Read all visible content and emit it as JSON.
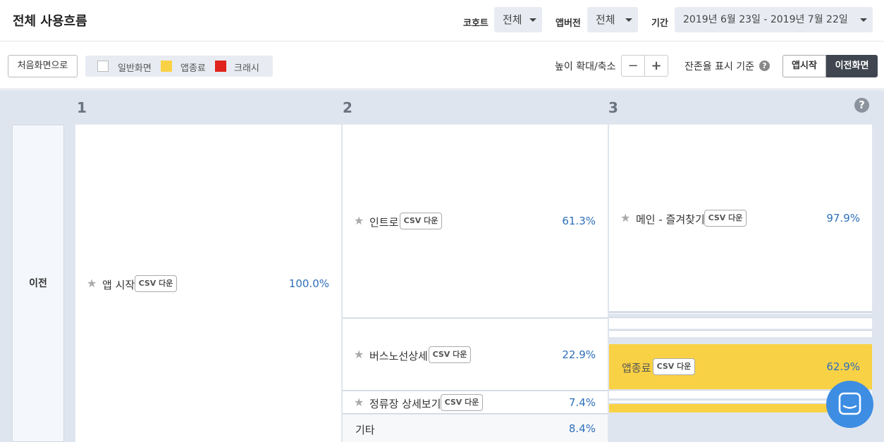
{
  "header": {
    "title": "전체 사용흐름",
    "cohort_label": "코호트",
    "cohort_value": "전체",
    "app_version_label": "앱버전",
    "app_version_value": "전체",
    "period_label": "기간",
    "period_value": "2019년 6월 23일 - 2019년 7월 22일"
  },
  "toolbar": {
    "home_button": "처음화면으로",
    "legend": [
      {
        "label": "일반화면",
        "color": "#ffffff"
      },
      {
        "label": "앱종료",
        "color": "#f9d144"
      },
      {
        "label": "크래시",
        "color": "#e0231c"
      }
    ],
    "zoom_label": "높이 확대/축소",
    "zoom_out": "−",
    "zoom_in": "+",
    "retention_label": "잔존율 표시 기준",
    "help": "?",
    "retention_options": [
      "앱시작",
      "이전화면"
    ],
    "retention_selected": "이전화면"
  },
  "flow": {
    "help": "?",
    "side_label": "이전",
    "steps": [
      "1",
      "2",
      "3"
    ],
    "csv_label": "CSV 다운",
    "columns": [
      {
        "nodes": [
          {
            "name": "앱 시작",
            "percent": "100.0%"
          }
        ]
      },
      {
        "nodes": [
          {
            "name": "인트로",
            "percent": "61.3%"
          },
          {
            "name": "버스노선상세",
            "percent": "22.9%"
          },
          {
            "name": "정류장 상세보기",
            "percent": "7.4%"
          },
          {
            "name": "기타",
            "percent": "8.4%"
          }
        ]
      },
      {
        "nodes": [
          {
            "name": "메인 - 즐겨찾기",
            "percent": "97.9%"
          },
          {
            "name": "앱종료",
            "percent": "62.9%"
          }
        ]
      }
    ]
  },
  "colors": {
    "accent_blue": "#2e6fba",
    "exit_yellow": "#f9d144",
    "crash_red": "#e0231c",
    "intercom": "#3d8de3"
  }
}
